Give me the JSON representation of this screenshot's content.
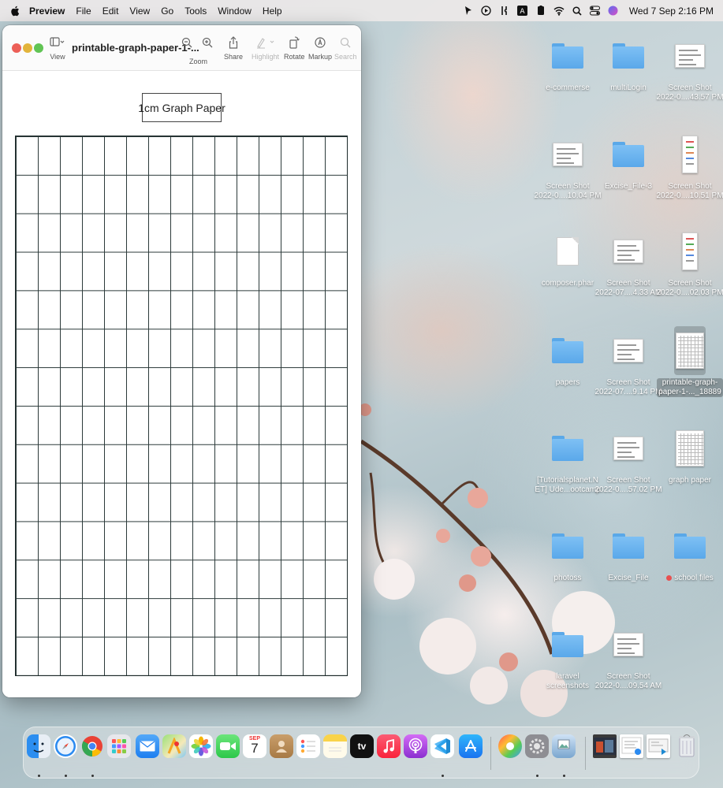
{
  "menubar": {
    "app_name": "Preview",
    "menus": [
      "File",
      "Edit",
      "View",
      "Go",
      "Tools",
      "Window",
      "Help"
    ],
    "clock": "Wed 7 Sep  2:16 PM"
  },
  "window": {
    "doc_title": "printable-graph-paper-1-...",
    "toolbar": {
      "view_label": "View",
      "zoom_label": "Zoom",
      "share_label": "Share",
      "highlight_label": "Highlight",
      "rotate_label": "Rotate",
      "markup_label": "Markup",
      "search_label": "Search"
    },
    "paper_title": "1cm Graph Paper",
    "grid": {
      "columns": 15,
      "rows": 14
    }
  },
  "desktop": {
    "icons": [
      {
        "kind": "folder",
        "line1": "e-commerse",
        "line2": ""
      },
      {
        "kind": "folder",
        "line1": "multiLogin",
        "line2": ""
      },
      {
        "kind": "shot",
        "line1": "Screen Shot",
        "line2": "2022-0....43.57 PM"
      },
      {
        "kind": "shot",
        "line1": "Screen Shot",
        "line2": "2022-0....10.04 PM"
      },
      {
        "kind": "folder",
        "line1": "Excise_File-3",
        "line2": ""
      },
      {
        "kind": "shot-tall",
        "line1": "Screen Shot",
        "line2": "2022-0....10.51 PM"
      },
      {
        "kind": "doc",
        "line1": "composer.phar",
        "line2": ""
      },
      {
        "kind": "shot",
        "line1": "Screen Shot",
        "line2": "2022-07....4.33 AM"
      },
      {
        "kind": "shot-tall",
        "line1": "Screen Shot",
        "line2": "2022-0....02.03 PM"
      },
      {
        "kind": "folder",
        "line1": "papers",
        "line2": ""
      },
      {
        "kind": "shot",
        "line1": "Screen Shot",
        "line2": "2022-07....9.14 PM"
      },
      {
        "kind": "page",
        "line1": "printable-graph-",
        "line2": "paper-1-..._18889"
      },
      {
        "kind": "folder",
        "line1": "[Tutorialsplanet.N",
        "line2": "ET] Ude...ootcamp"
      },
      {
        "kind": "shot",
        "line1": "Screen Shot",
        "line2": "2022-0....57.02 PM"
      },
      {
        "kind": "page",
        "line1": "graph paper",
        "line2": ""
      },
      {
        "kind": "folder",
        "line1": "photoss",
        "line2": ""
      },
      {
        "kind": "folder",
        "line1": "Excise_File",
        "line2": ""
      },
      {
        "kind": "folder",
        "line1": "school files",
        "line2": ""
      },
      {
        "kind": "folder",
        "line1": "laravel",
        "line2": "screenshots"
      },
      {
        "kind": "shot",
        "line1": "Screen Shot",
        "line2": "2022-0....09.54 AM"
      }
    ]
  },
  "dock": {
    "calendar_month": "SEP",
    "calendar_day": "7",
    "tv_label": "tv"
  }
}
